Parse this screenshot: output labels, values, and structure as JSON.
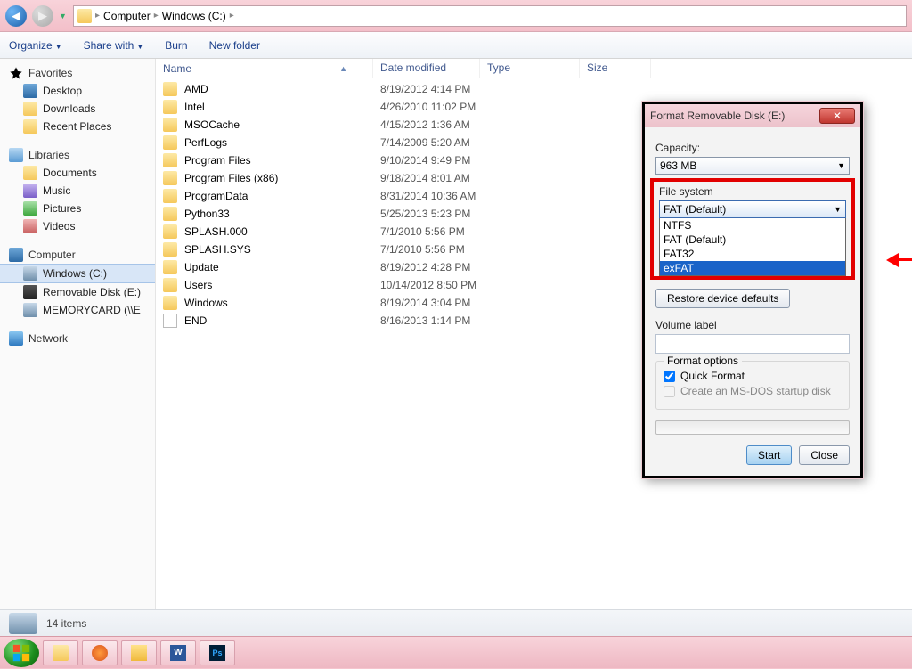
{
  "breadcrumb": {
    "root": "Computer",
    "drive": "Windows (C:)"
  },
  "toolbar": {
    "organize": "Organize",
    "share": "Share with",
    "burn": "Burn",
    "newfolder": "New folder"
  },
  "columns": {
    "name": "Name",
    "date": "Date modified",
    "type": "Type",
    "size": "Size"
  },
  "sidebar": {
    "favorites": "Favorites",
    "fav_items": [
      "Desktop",
      "Downloads",
      "Recent Places"
    ],
    "libraries": "Libraries",
    "lib_items": [
      "Documents",
      "Music",
      "Pictures",
      "Videos"
    ],
    "computer": "Computer",
    "comp_items": [
      "Windows (C:)",
      "Removable Disk (E:)",
      "MEMORYCARD (\\\\E"
    ],
    "network": "Network"
  },
  "files": [
    {
      "name": "AMD",
      "date": "8/19/2012 4:14 PM",
      "icon": "folder"
    },
    {
      "name": "Intel",
      "date": "4/26/2010 11:02 PM",
      "icon": "folder"
    },
    {
      "name": "MSOCache",
      "date": "4/15/2012 1:36 AM",
      "icon": "folder"
    },
    {
      "name": "PerfLogs",
      "date": "7/14/2009 5:20 AM",
      "icon": "folder"
    },
    {
      "name": "Program Files",
      "date": "9/10/2014 9:49 PM",
      "icon": "folder"
    },
    {
      "name": "Program Files (x86)",
      "date": "9/18/2014 8:01 AM",
      "icon": "folder"
    },
    {
      "name": "ProgramData",
      "date": "8/31/2014 10:36 AM",
      "icon": "folder"
    },
    {
      "name": "Python33",
      "date": "5/25/2013 5:23 PM",
      "icon": "folder"
    },
    {
      "name": "SPLASH.000",
      "date": "7/1/2010 5:56 PM",
      "icon": "folder"
    },
    {
      "name": "SPLASH.SYS",
      "date": "7/1/2010 5:56 PM",
      "icon": "folder"
    },
    {
      "name": "Update",
      "date": "8/19/2012 4:28 PM",
      "icon": "folder"
    },
    {
      "name": "Users",
      "date": "10/14/2012 8:50 PM",
      "icon": "folder"
    },
    {
      "name": "Windows",
      "date": "8/19/2014 3:04 PM",
      "icon": "folder"
    },
    {
      "name": "END",
      "date": "8/16/2013 1:14 PM",
      "icon": "file"
    }
  ],
  "dialog": {
    "title": "Format Removable Disk (E:)",
    "capacity_label": "Capacity:",
    "capacity_value": "963 MB",
    "fs_label": "File system",
    "fs_selected": "FAT (Default)",
    "fs_options": [
      "NTFS",
      "FAT (Default)",
      "FAT32",
      "exFAT"
    ],
    "fs_highlight_index": 3,
    "restore": "Restore device defaults",
    "volume_label": "Volume label",
    "fopts": "Format options",
    "quick": "Quick Format",
    "msdos": "Create an MS-DOS startup disk",
    "start": "Start",
    "close": "Close"
  },
  "status": {
    "count": "14 items"
  },
  "taskbar_items": [
    "explorer",
    "firefox",
    "app",
    "word",
    "photoshop"
  ]
}
